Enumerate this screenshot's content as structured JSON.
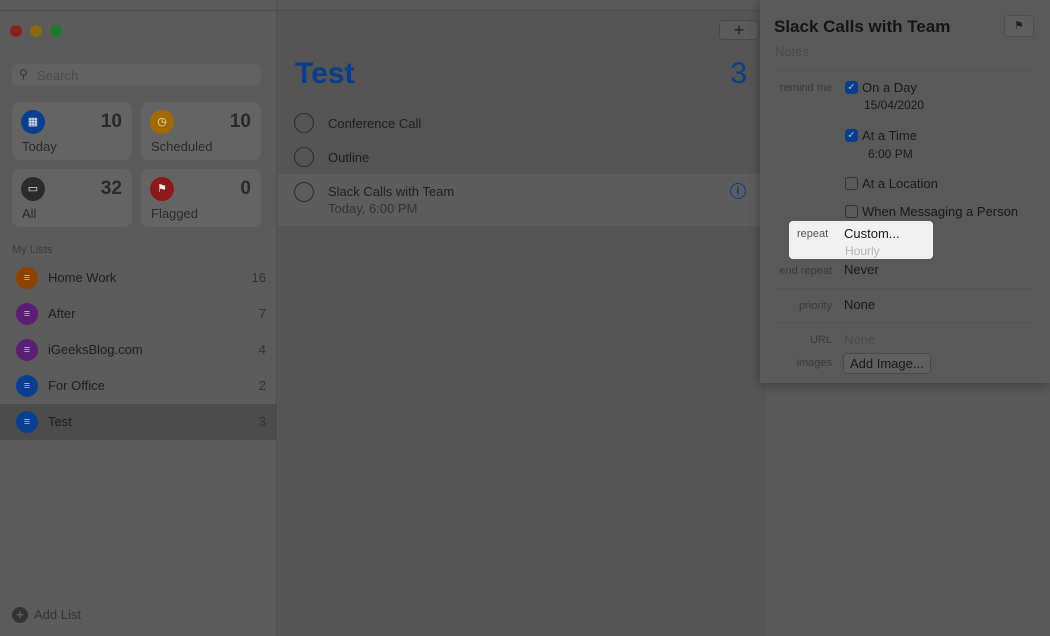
{
  "sidebar": {
    "search_placeholder": "Search",
    "smart_lists": [
      {
        "label": "Today",
        "count": "10",
        "color": "#0a3f8f"
      },
      {
        "label": "Scheduled",
        "count": "10",
        "color": "#a06a00"
      },
      {
        "label": "All",
        "count": "32",
        "color": "#2b2b2b"
      },
      {
        "label": "Flagged",
        "count": "0",
        "color": "#8d1a1a"
      }
    ],
    "my_lists_header": "My Lists",
    "lists": [
      {
        "name": "Home Work",
        "count": "16",
        "color": "#8a4300"
      },
      {
        "name": "After",
        "count": "7",
        "color": "#5a1f72"
      },
      {
        "name": "iGeeksBlog.com",
        "count": "4",
        "color": "#5a1f72"
      },
      {
        "name": "For Office",
        "count": "2",
        "color": "#0a3f8f"
      },
      {
        "name": "Test",
        "count": "3",
        "color": "#0a3f8f"
      }
    ],
    "add_list": "Add List"
  },
  "main": {
    "add_button": "+",
    "title": "Test",
    "count": "3",
    "tasks": [
      {
        "title": "Conference Call"
      },
      {
        "title": "Outline"
      },
      {
        "title": "Slack Calls with Team",
        "subtitle": "Today, 6:00 PM"
      }
    ],
    "info_icon": "i"
  },
  "detail": {
    "title": "Slack Calls with Team",
    "notes_placeholder": "Notes",
    "remind_me_label": "remind me",
    "on_a_day": {
      "label": "On a Day",
      "checked": true,
      "value": "15/04/2020"
    },
    "at_a_time": {
      "label": "At a Time",
      "checked": true,
      "value": "6:00 PM"
    },
    "at_a_location": {
      "label": "At a Location",
      "checked": false
    },
    "when_messaging": {
      "label": "When Messaging a Person",
      "checked": false
    },
    "repeat_label": "repeat",
    "repeat_value": "Custom...",
    "repeat_sub": "Hourly",
    "end_repeat_label": "end repeat",
    "end_repeat_value": "Never",
    "priority_label": "priority",
    "priority_value": "None",
    "url_label": "URL",
    "url_placeholder": "None",
    "images_label": "images",
    "add_image": "Add Image..."
  }
}
